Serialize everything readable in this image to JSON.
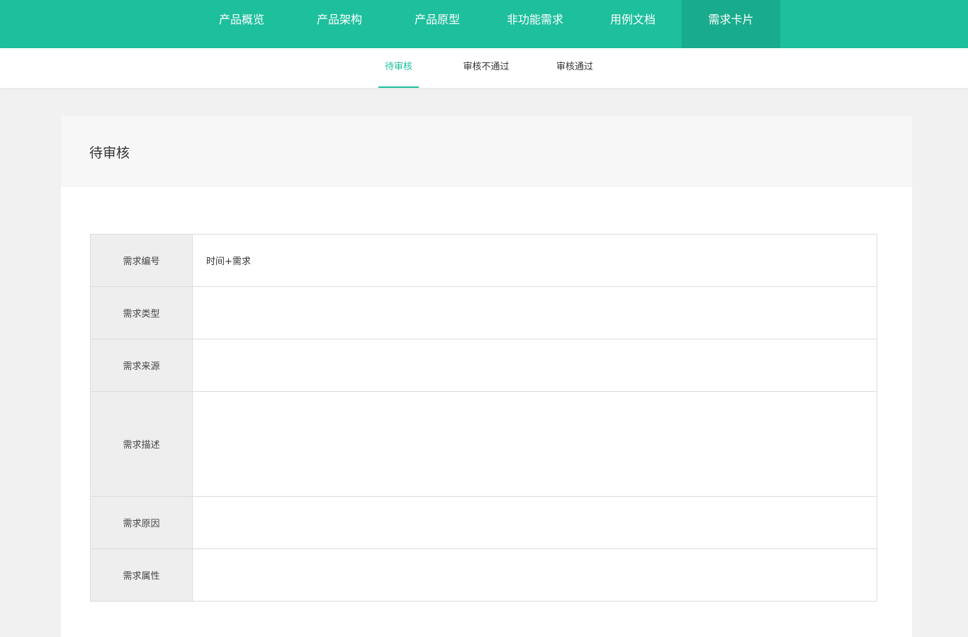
{
  "top_nav": {
    "items": [
      {
        "label": "产品概览"
      },
      {
        "label": "产品架构"
      },
      {
        "label": "产品原型"
      },
      {
        "label": "非功能需求"
      },
      {
        "label": "用例文档"
      },
      {
        "label": "需求卡片",
        "active": true
      }
    ]
  },
  "sub_nav": {
    "tabs": [
      {
        "label": "待审核",
        "active": true
      },
      {
        "label": "审核不通过"
      },
      {
        "label": "审核通过"
      }
    ]
  },
  "card": {
    "title": "待审核",
    "fields": [
      {
        "label": "需求编号",
        "value": "时间+需求"
      },
      {
        "label": "需求类型",
        "value": ""
      },
      {
        "label": "需求来源",
        "value": ""
      },
      {
        "label": "需求描述",
        "value": ""
      },
      {
        "label": "需求原因",
        "value": ""
      },
      {
        "label": "需求属性",
        "value": ""
      }
    ]
  },
  "colors": {
    "brand": "#1dbf9d",
    "brand_active": "#19ab8d",
    "page_background": "#f1f1f1"
  }
}
